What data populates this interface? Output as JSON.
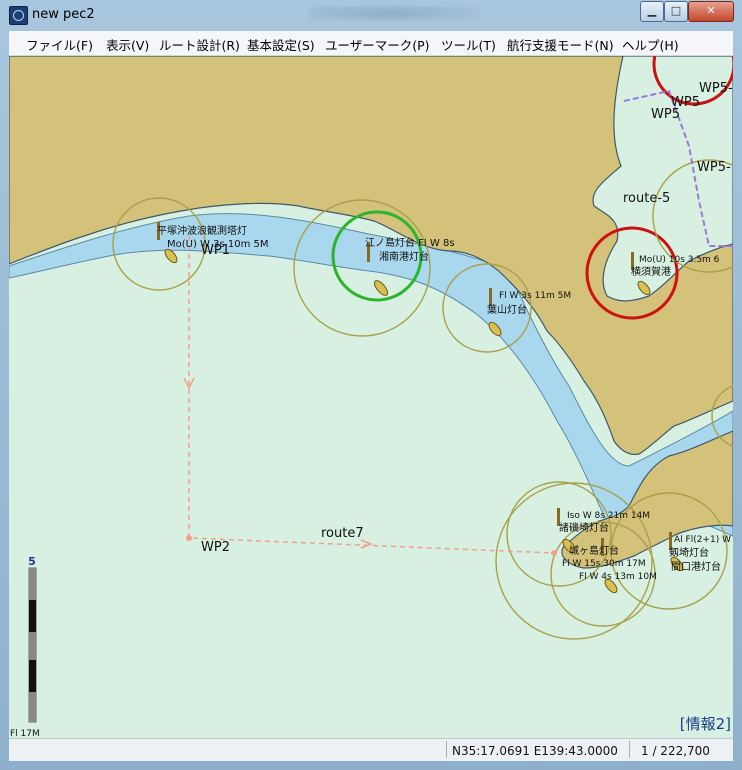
{
  "window": {
    "title": "new pec2"
  },
  "menu": [
    {
      "label": "ファイル(F)"
    },
    {
      "label": "表示(V)"
    },
    {
      "label": "ルート設計(R)"
    },
    {
      "label": "基本設定(S)"
    },
    {
      "label": "ユーザーマーク(P)"
    },
    {
      "label": "ツール(T)"
    },
    {
      "label": "航行支援モード(N)"
    },
    {
      "label": "ヘルプ(H)"
    }
  ],
  "map": {
    "waypoints": {
      "wp1": "WP1",
      "wp2": "WP2",
      "wp5a": "WP5",
      "wp5b": "WP5",
      "wp5c": "WP5-",
      "wp5d": "WP5-"
    },
    "routes": {
      "route7": "route7",
      "route5": "route-5"
    },
    "lights": {
      "hiratsuka_char": "Mo(U) W 3s 10m 5M",
      "hiratsuka_name": "平塚沖波浪観測塔灯",
      "shonan_name": "湘南港灯台",
      "shonan_char": "江ノ島灯台 Fl W 8s",
      "hayama_char": "Fl W 3s 11m 5M",
      "hayama_name": "葉山灯台",
      "yokosuka_char": "Mo(U) 10s 3.5m 6",
      "yokosuka_name": "横須賀港",
      "jogashima_char": "Iso W 8s 21m 14M",
      "jogashima_name": "諸磯埼灯台",
      "jogashima2_name": "城ヶ島灯台",
      "jogashima2_char": "Fl W 15s 30m 17M",
      "tsurugi_char": "Al Fl(2+1) W",
      "tsurugi_name": "剱埼灯台",
      "tsurugi2_name": "間口港灯台",
      "misaki_char": "Fl W 4s 13m 10M"
    },
    "scale_bar": {
      "top_label": "5",
      "bottom_label": "Fl 17M"
    },
    "info_label": "[情報2]"
  },
  "status": {
    "coords": "N35:17.0691 E139:43.0000",
    "scale": "1 / 222,700"
  },
  "colors": {
    "land": "#d4c27a",
    "shallow_water": "#a9d7ed",
    "sea": "#d8f0e2",
    "light_ring": "#e2dc8a",
    "route": "#f2a08a",
    "selected_ring": "#2ab52a",
    "alert_ring": "#cc1111"
  }
}
